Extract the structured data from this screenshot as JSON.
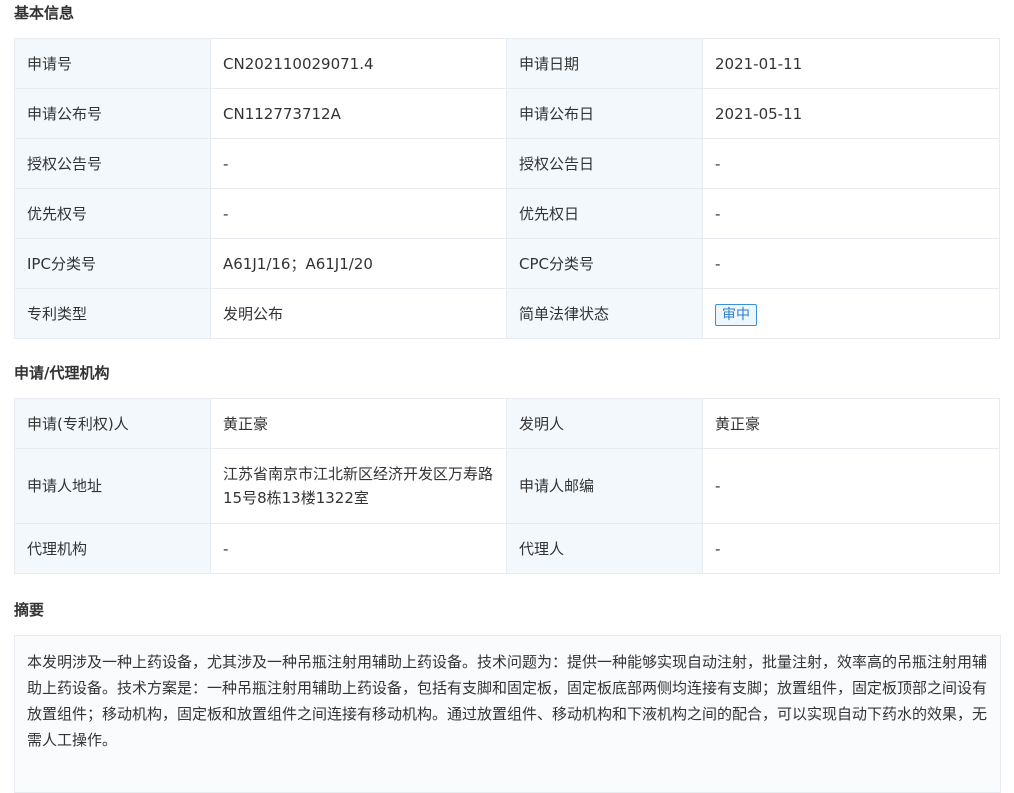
{
  "sections": {
    "basic": {
      "title": "基本信息",
      "rows": [
        {
          "l1": "申请号",
          "v1": "CN202110029071.4",
          "l2": "申请日期",
          "v2": "2021-01-11"
        },
        {
          "l1": "申请公布号",
          "v1": "CN112773712A",
          "l2": "申请公布日",
          "v2": "2021-05-11"
        },
        {
          "l1": "授权公告号",
          "v1": "-",
          "l2": "授权公告日",
          "v2": "-"
        },
        {
          "l1": "优先权号",
          "v1": "-",
          "l2": "优先权日",
          "v2": "-"
        },
        {
          "l1": "IPC分类号",
          "v1": "A61J1/16；A61J1/20",
          "l2": "CPC分类号",
          "v2": "-"
        },
        {
          "l1": "专利类型",
          "v1": "发明公布",
          "l2": "简单法律状态",
          "v2": "审中"
        }
      ]
    },
    "agency": {
      "title": "申请/代理机构",
      "rows": [
        {
          "l1": "申请(专利权)人",
          "v1": "黄正豪",
          "l2": "发明人",
          "v2": "黄正豪"
        },
        {
          "l1": "申请人地址",
          "v1": "江苏省南京市江北新区经济开发区万寿路15号8栋13楼1322室",
          "l2": "申请人邮编",
          "v2": "-"
        },
        {
          "l1": "代理机构",
          "v1": "-",
          "l2": "代理人",
          "v2": "-"
        }
      ]
    },
    "abstract": {
      "title": "摘要",
      "text": "本发明涉及一种上药设备，尤其涉及一种吊瓶注射用辅助上药设备。技术问题为：提供一种能够实现自动注射，批量注射，效率高的吊瓶注射用辅助上药设备。技术方案是：一种吊瓶注射用辅助上药设备，包括有支脚和固定板，固定板底部两侧均连接有支脚；放置组件，固定板顶部之间设有放置组件；移动机构，固定板和放置组件之间连接有移动机构。通过放置组件、移动机构和下液机构之间的配合，可以实现自动下药水的效果，无需人工操作。"
    }
  },
  "colors": {
    "label_bg": "#f3f8fd",
    "border": "#e8ecf0",
    "badge": "#2d7fcb"
  }
}
